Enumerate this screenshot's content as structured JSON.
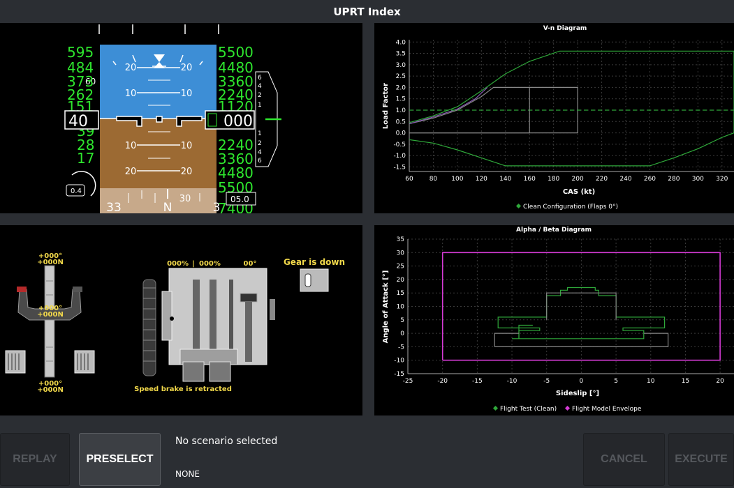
{
  "header": {
    "title": "UPRT Index"
  },
  "pfd": {
    "pitch_labels_up": [
      "20",
      "10"
    ],
    "pitch_labels_down": [
      "10",
      "20"
    ],
    "speed_tape": [
      "595",
      "484",
      "373",
      "262",
      "151",
      "40",
      "39",
      "28",
      "17"
    ],
    "speed_current": "40",
    "alt_tape": [
      "5500",
      "4480",
      "3360",
      "2240",
      "1120",
      "2240",
      "3360",
      "4480",
      "5500",
      "7400"
    ],
    "alt_current": "000",
    "vs_scale": [
      "6",
      "4",
      "2",
      "1",
      "1",
      "2",
      "4",
      "6"
    ],
    "heading_labels": [
      "33",
      "N",
      "3"
    ],
    "heading_ticks": [
      "30"
    ],
    "heading_box": "05.0",
    "gload": "0.4",
    "left_extra": "60"
  },
  "vn": {
    "chart_data": {
      "type": "line",
      "title": "V-n Diagram",
      "xlabel": "CAS (kt)",
      "ylabel": "Load Factor",
      "xlim": [
        60,
        330
      ],
      "ylim": [
        -1.7,
        4.1
      ],
      "xticks": [
        60,
        80,
        100,
        120,
        140,
        160,
        180,
        200,
        220,
        240,
        260,
        280,
        300,
        320
      ],
      "yticks": [
        -1.5,
        -1.0,
        -0.5,
        0.0,
        0.5,
        1.0,
        1.5,
        2.0,
        2.5,
        3.0,
        3.5,
        4.0
      ],
      "legend": [
        {
          "name": "Clean Configuration (Flaps 0°)",
          "color": "#2fa83a"
        }
      ],
      "series": [
        {
          "name": "Clean Configuration (Flaps 0°)",
          "color": "#2fa83a",
          "points": [
            [
              60,
              0.45
            ],
            [
              80,
              0.75
            ],
            [
              100,
              1.15
            ],
            [
              120,
              1.85
            ],
            [
              140,
              2.6
            ],
            [
              160,
              3.15
            ],
            [
              185,
              3.6
            ],
            [
              330,
              3.6
            ],
            [
              330,
              0
            ],
            [
              320,
              -0.2
            ],
            [
              300,
              -0.7
            ],
            [
              280,
              -1.1
            ],
            [
              260,
              -1.45
            ],
            [
              140,
              -1.45
            ],
            [
              120,
              -1.1
            ],
            [
              100,
              -0.75
            ],
            [
              80,
              -0.45
            ],
            [
              60,
              -0.3
            ]
          ]
        },
        {
          "name": "gray envelope",
          "color": "#888888",
          "points": [
            [
              60,
              0.4
            ],
            [
              80,
              0.65
            ],
            [
              100,
              1.0
            ],
            [
              120,
              1.6
            ],
            [
              130,
              2.0
            ],
            [
              200,
              2.0
            ],
            [
              200,
              0
            ],
            [
              60,
              0
            ]
          ]
        },
        {
          "name": "purple curve",
          "color": "#8a5bb5",
          "points": [
            [
              60,
              0.4
            ],
            [
              80,
              0.7
            ],
            [
              100,
              1.05
            ],
            [
              115,
              1.5
            ],
            [
              125,
              2.0
            ]
          ]
        },
        {
          "name": "level 1g",
          "color": "#2fa83a",
          "dashed": true,
          "points": [
            [
              60,
              1.0
            ],
            [
              330,
              1.0
            ]
          ]
        }
      ],
      "inner_gray": [
        [
          60,
          0
        ],
        [
          160,
          0
        ],
        [
          160,
          2.0
        ]
      ]
    }
  },
  "ab": {
    "chart_data": {
      "type": "line",
      "title": "Alpha / Beta Diagram",
      "xlabel": "Sideslip [°]",
      "ylabel": "Angle of Attack [°]",
      "xlim": [
        -25,
        22
      ],
      "ylim": [
        -15,
        35
      ],
      "xticks": [
        -25,
        -20,
        -15,
        -10,
        -5,
        0,
        5,
        10,
        15,
        20
      ],
      "yticks": [
        -15,
        -10,
        -5,
        0,
        5,
        10,
        15,
        20,
        25,
        30,
        35
      ],
      "legend": [
        {
          "name": "Flight Test (Clean)",
          "color": "#2fa83a"
        },
        {
          "name": "Flight Model Envelope",
          "color": "#d63bd6"
        }
      ],
      "series": [
        {
          "name": "Flight Model Envelope",
          "color": "#d63bd6",
          "points": [
            [
              -20,
              -10
            ],
            [
              20,
              -10
            ],
            [
              20,
              30
            ],
            [
              -20,
              30
            ],
            [
              -20,
              -10
            ]
          ]
        },
        {
          "name": "Flight Test (Clean)",
          "color": "#2fa83a",
          "points": [
            [
              -10,
              -2
            ],
            [
              9,
              -2
            ],
            [
              9,
              1
            ],
            [
              6,
              1
            ],
            [
              6,
              2
            ],
            [
              12,
              2
            ],
            [
              12,
              6
            ],
            [
              5,
              6
            ],
            [
              5,
              14
            ],
            [
              2.5,
              14
            ],
            [
              2.5,
              16
            ],
            [
              2,
              16
            ],
            [
              2,
              17
            ],
            [
              -2,
              17
            ],
            [
              -2,
              16
            ],
            [
              -3,
              16
            ],
            [
              -3,
              14
            ],
            [
              -5,
              14
            ],
            [
              -5,
              6
            ],
            [
              -12,
              6
            ],
            [
              -12,
              2
            ],
            [
              -6,
              2
            ],
            [
              -6,
              1
            ],
            [
              -9,
              1
            ],
            [
              -9,
              -2
            ]
          ]
        },
        {
          "name": "Flight Test (Clean) inner",
          "color": "#2fa83a",
          "points": [
            [
              -9,
              -2
            ],
            [
              -9,
              3
            ],
            [
              -7,
              3
            ]
          ]
        },
        {
          "name": "gray",
          "color": "#888888",
          "points": [
            [
              -12.5,
              -5
            ],
            [
              12.5,
              -5
            ],
            [
              12.5,
              0
            ],
            [
              9,
              0
            ]
          ]
        },
        {
          "name": "gray2",
          "color": "#888888",
          "points": [
            [
              -12.5,
              -5
            ],
            [
              -12.5,
              0
            ],
            [
              -9,
              0
            ]
          ]
        },
        {
          "name": "gray3",
          "color": "#888888",
          "points": [
            [
              -5,
              5
            ],
            [
              -5,
              15
            ],
            [
              -3,
              15
            ],
            [
              -3,
              15
            ],
            [
              5,
              15
            ],
            [
              5,
              5
            ]
          ]
        }
      ]
    }
  },
  "controls": {
    "stick_top": "+000°\n+000N",
    "stick_top_1": "+000°",
    "stick_top_2": "+000N",
    "stick_mid_1": "+000°",
    "stick_mid_2": "+000N",
    "stick_bot_1": "+000°",
    "stick_bot_2": "+000N",
    "throttle_left": "000%",
    "throttle_sep": "|",
    "throttle_right": "000%",
    "flaps": "00°",
    "gear_status": "Gear is down",
    "speedbrake_status": "Speed brake is retracted"
  },
  "bottom": {
    "replay": "REPLAY",
    "preselect": "PRESELECT",
    "scenario_title": "No scenario selected",
    "scenario_sub": "NONE",
    "cancel": "CANCEL",
    "execute": "EXECUTE"
  }
}
